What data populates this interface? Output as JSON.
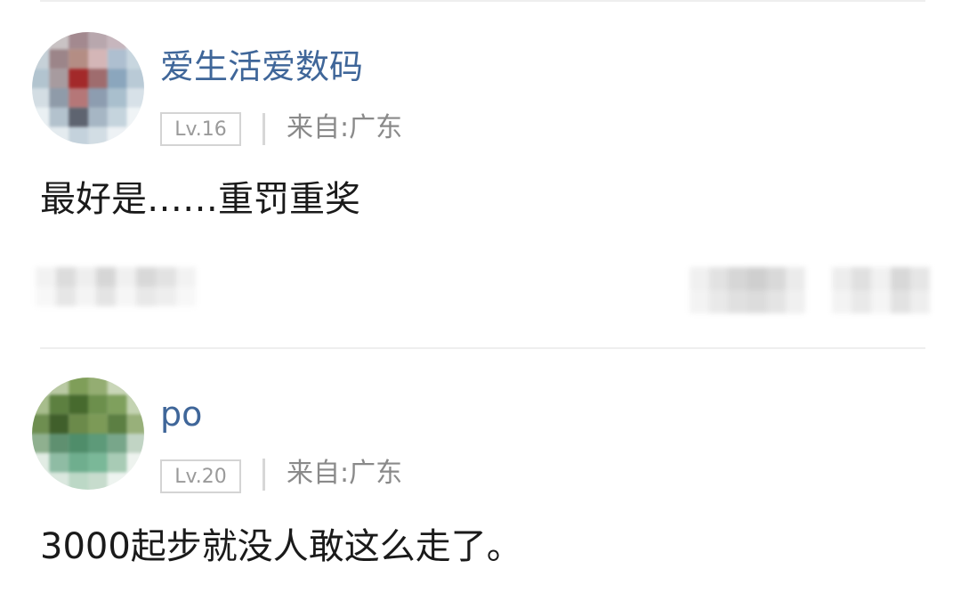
{
  "comments": [
    {
      "username": "爱生活爱数码",
      "level": "Lv.16",
      "location": "来自:广东",
      "text": "最好是……重罚重奖"
    },
    {
      "username": "po",
      "level": "Lv.20",
      "location": "来自:广东",
      "text": "3000起步就没人敢这么走了。"
    }
  ],
  "icons": {
    "avatar_1": "avatar-pixelated",
    "avatar_2": "avatar-pixelated",
    "actions": [
      "reply-icon",
      "like-icon"
    ]
  },
  "colors": {
    "username": "#3f6699",
    "badge_border": "#d4d4d4",
    "badge_text": "#9a9a9a",
    "location_text": "#8a8a8a",
    "comment_text": "#1a1a1a",
    "divider": "#eeeeee"
  }
}
